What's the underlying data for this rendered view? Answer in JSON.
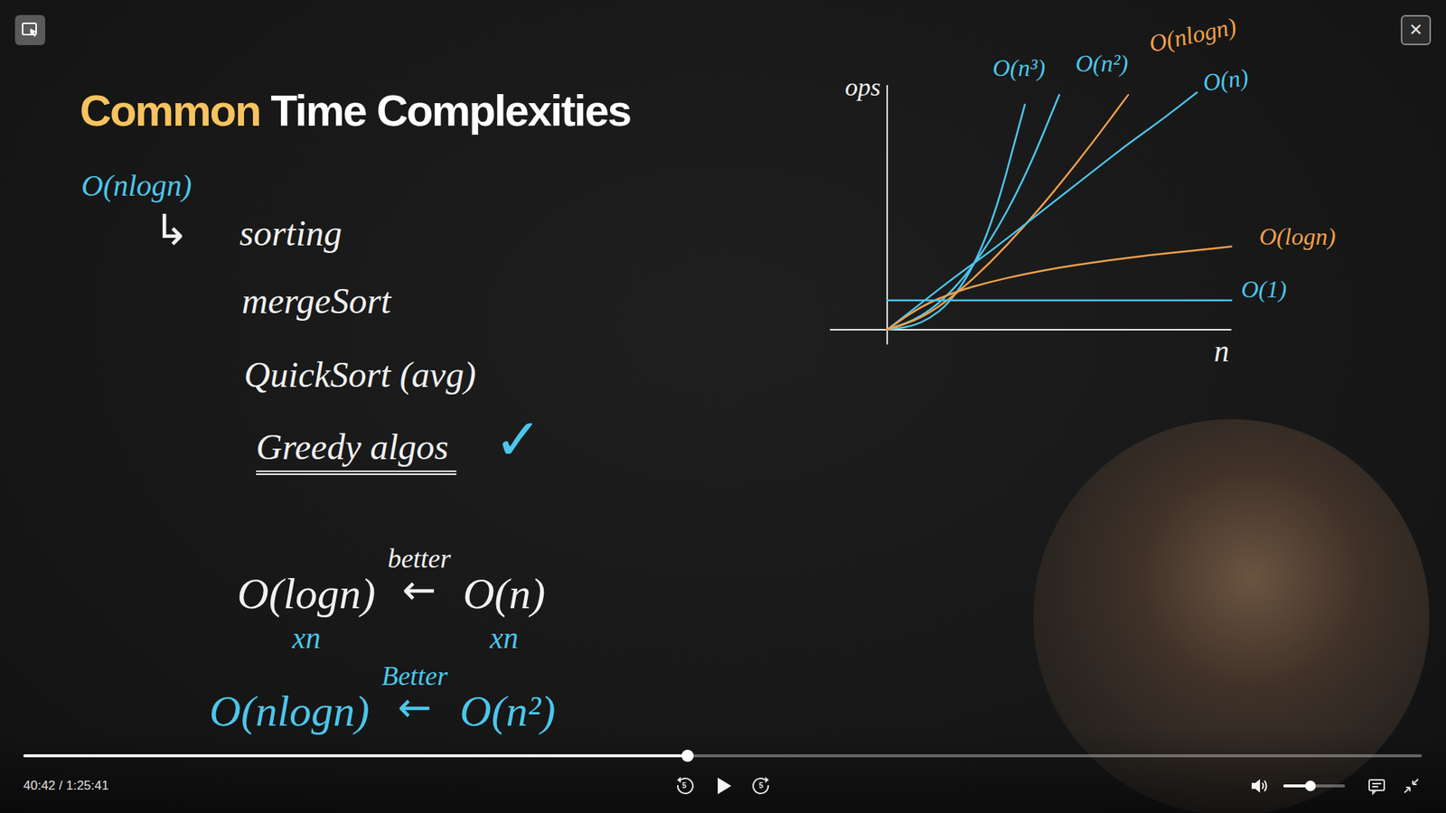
{
  "slide": {
    "title_highlight": "Common",
    "title_rest": "Time Complexities",
    "heading": "O(nlogn)",
    "arrow": "↳",
    "items": [
      {
        "text": "sorting",
        "underlined": false
      },
      {
        "text": "mergeSort",
        "underlined": false
      },
      {
        "text": "QuickSort (avg)",
        "underlined": false
      },
      {
        "text": "Greedy algos",
        "underlined": true
      }
    ],
    "check": "✓",
    "comparisons": [
      {
        "left": "O(logn)",
        "left_note": "xn",
        "arrow": "←",
        "label": "better",
        "right": "O(n)",
        "right_note": "xn",
        "color": "#f1f1f1"
      },
      {
        "left": "O(nlogn)",
        "left_note": "",
        "arrow": "←",
        "label": "Better",
        "right": "O(n²)",
        "right_note": "",
        "color": "#4cc6ea"
      }
    ]
  },
  "chart": {
    "y_label": "ops",
    "x_label": "n",
    "series": [
      {
        "name": "O(n³)",
        "color": "#4cc6ea",
        "values": [
          0,
          0.2,
          1.3,
          4,
          9.2
        ]
      },
      {
        "name": "O(n²)",
        "color": "#4cc6ea",
        "values": [
          0,
          0.5,
          1.7,
          3.6,
          6.2,
          9.6
        ]
      },
      {
        "name": "O(nlogn)",
        "color": "#f0a04b",
        "values": [
          0,
          0.46,
          1.45,
          2.74,
          4.25,
          5.91,
          7.7,
          9.6
        ]
      },
      {
        "name": "O(n)",
        "color": "#4cc6ea",
        "values": [
          0,
          1.1,
          2.2,
          3.2,
          4.3,
          5.4,
          6.5,
          7.6,
          8.6,
          9.7
        ]
      },
      {
        "name": "O(logn)",
        "color": "#f0a04b",
        "values": [
          0,
          0.98,
          1.56,
          1.96,
          2.28,
          2.54,
          2.75,
          2.94,
          3.11,
          3.25,
          3.4
        ]
      },
      {
        "name": "O(1)",
        "color": "#4cc6ea",
        "values": [
          1.2,
          1.2,
          1.2,
          1.2,
          1.2,
          1.2,
          1.2,
          1.2,
          1.2,
          1.2,
          1.2
        ]
      }
    ]
  },
  "player": {
    "close": "✕",
    "time": "40:42 / 1:25:41",
    "playing": false,
    "progress": {
      "level": 0.475
    },
    "volume": {
      "level": 0.44
    },
    "rewind_label": "5",
    "forward_label": "5"
  }
}
